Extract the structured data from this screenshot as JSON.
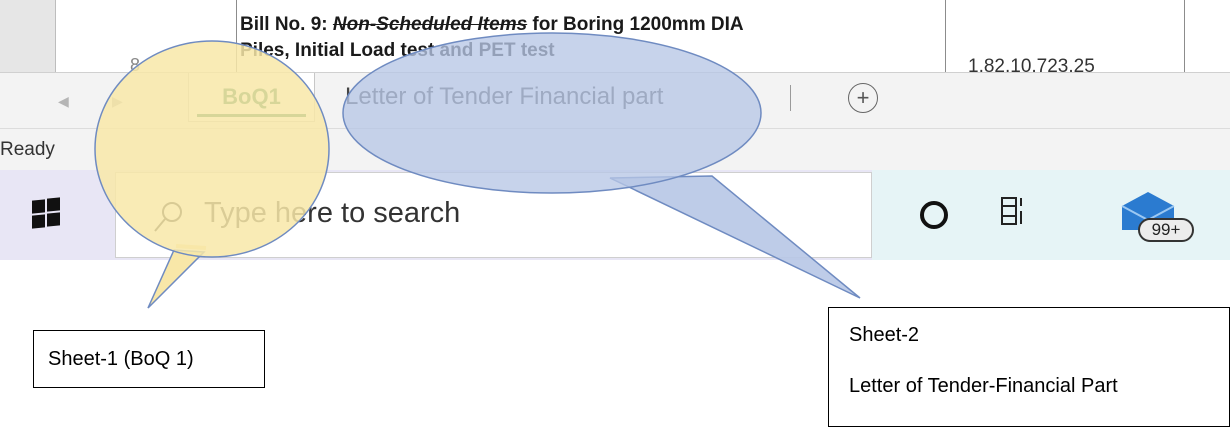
{
  "spreadsheet": {
    "cell_line1_prefix": "Bill No. 9: ",
    "cell_line1_italic": "Non-Scheduled Items",
    "cell_line1_suffix": " for Boring 1200mm DIA",
    "cell_line2_prefix": "Piles, Initial ",
    "cell_line2_mid": "Load test and PET test",
    "row_number": "8",
    "amount": "1,82,10,723.25"
  },
  "tabs": {
    "active": "BoQ1",
    "inactive": "Letter of Tender Financial part",
    "add_symbol": "+"
  },
  "status": {
    "text": "Ready"
  },
  "taskbar": {
    "search_placeholder": "Type here to search",
    "mail_badge": "99+"
  },
  "captions": {
    "sheet1": "Sheet-1 (BoQ 1)",
    "sheet2_line1": "Sheet-2",
    "sheet2_line2": "Letter of Tender-Financial Part"
  },
  "colors": {
    "yellow_balloon": "#f8e7a8",
    "blue_balloon": "#b7c7e6",
    "excel_green": "#1e7145"
  }
}
